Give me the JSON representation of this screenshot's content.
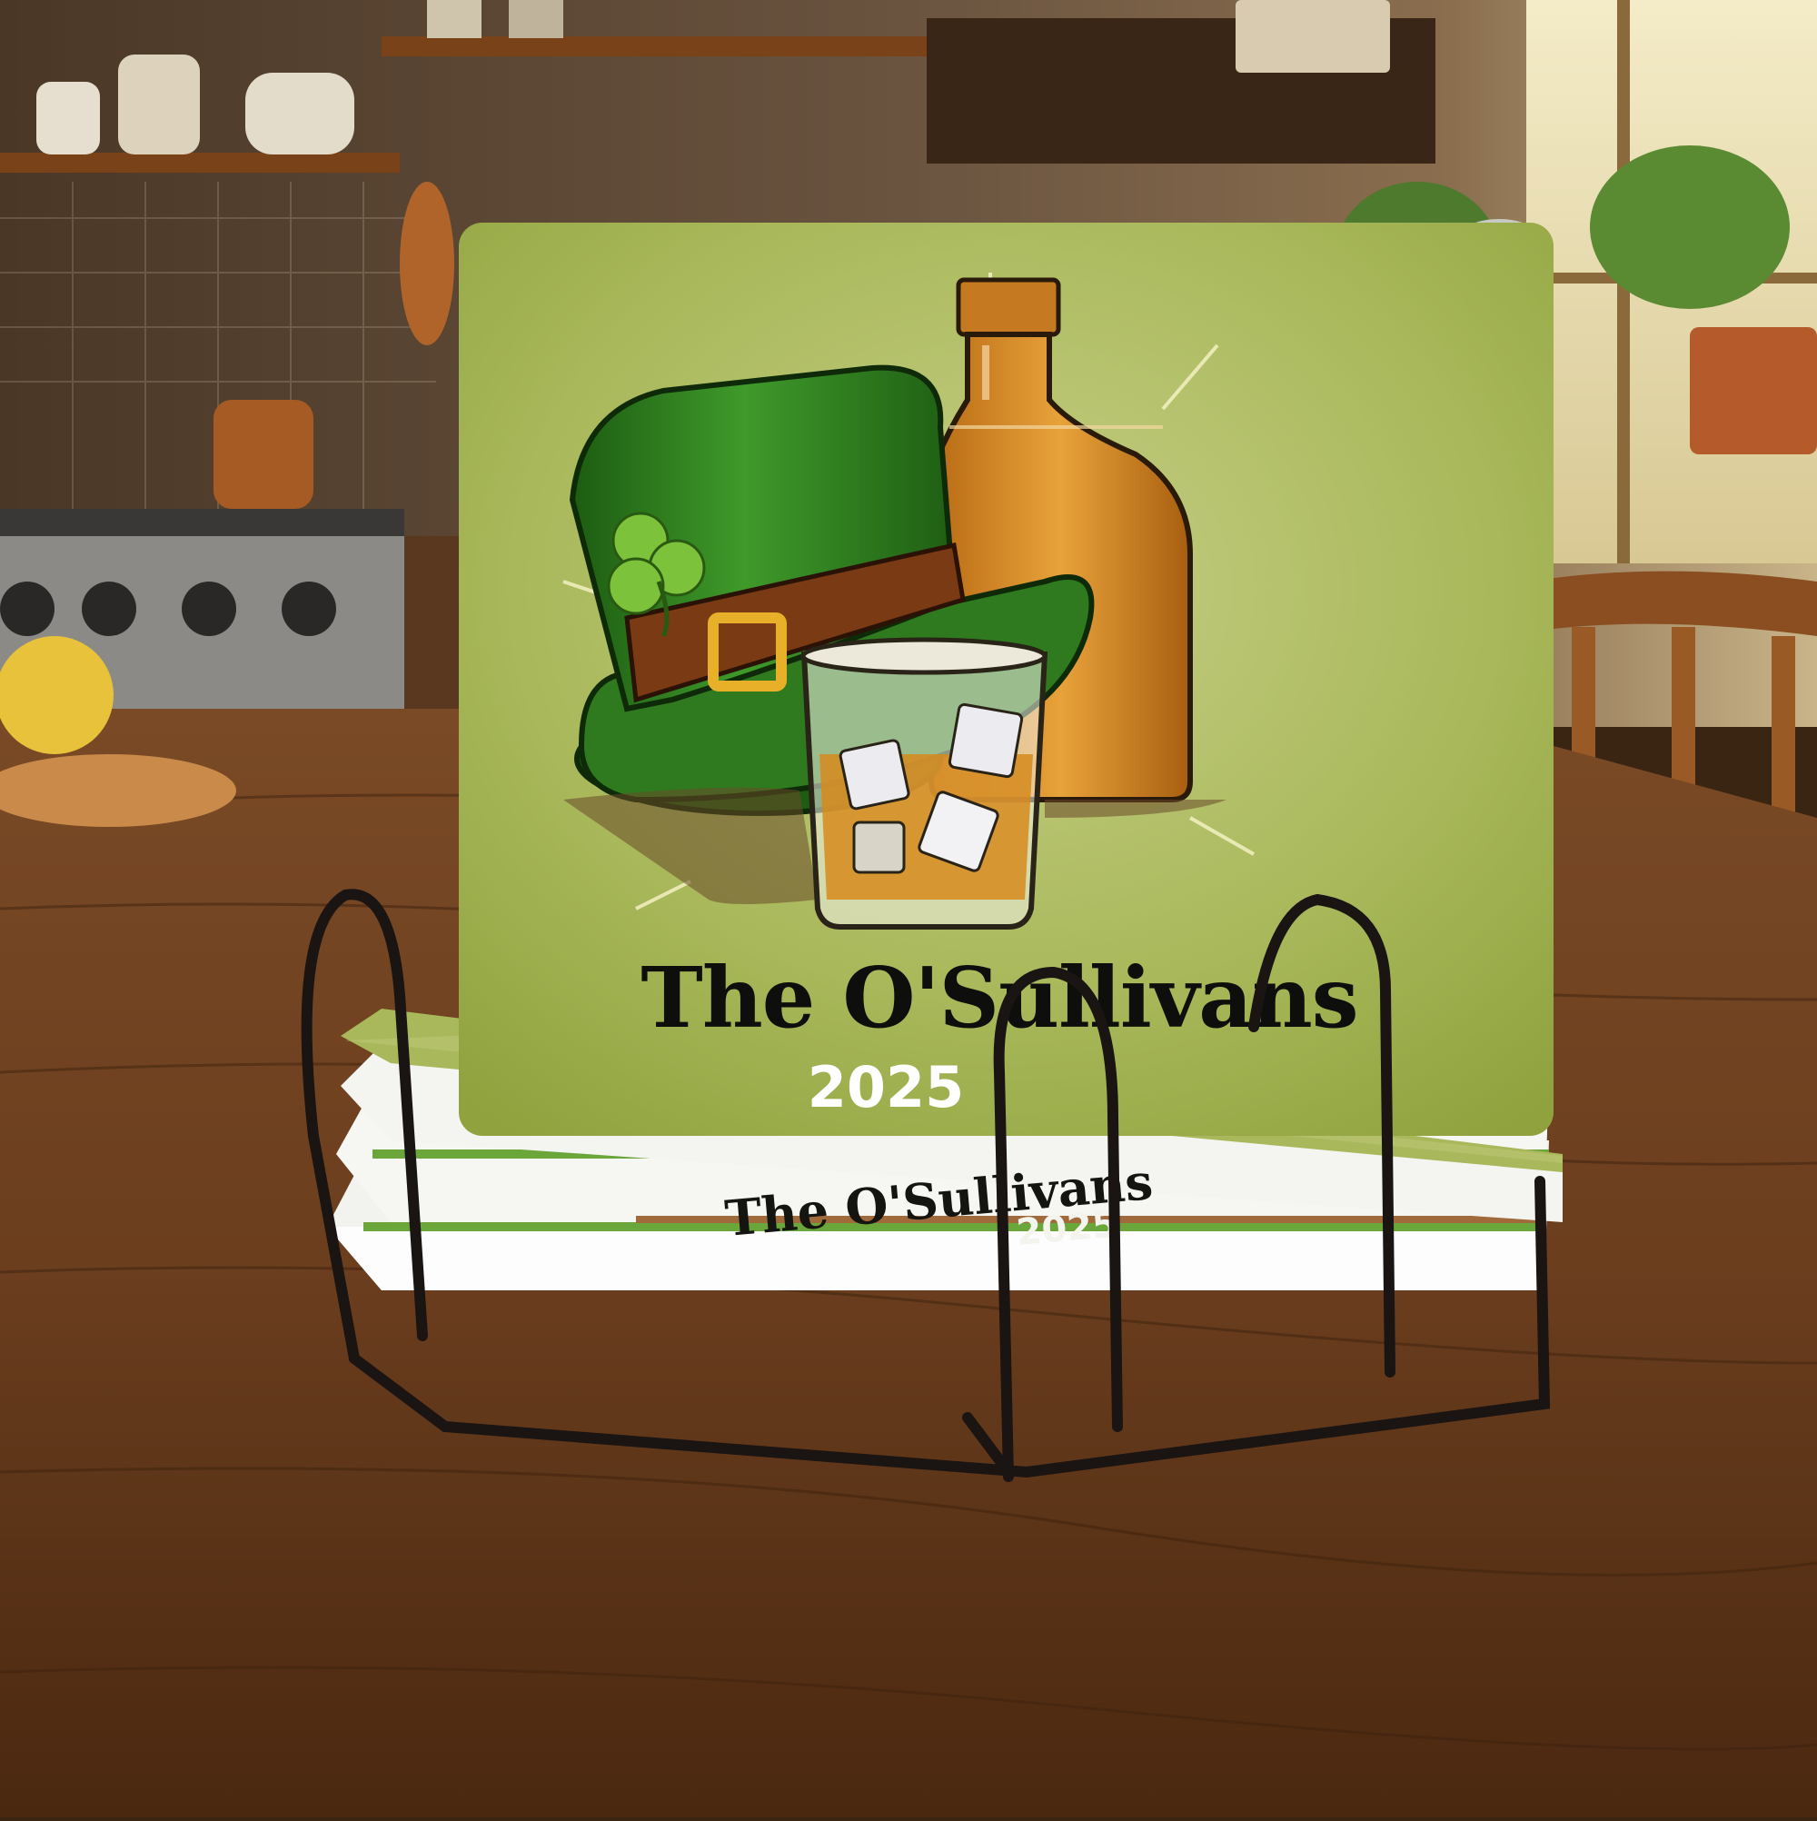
{
  "coaster": {
    "family_name": "The O'Sullivans",
    "year": "2025"
  },
  "stacked_coaster": {
    "family_name": "The O'Sullivans",
    "year": "2025"
  },
  "colors": {
    "coaster_green": "#a8b85a",
    "hat_green": "#2f7a1e",
    "whiskey_amber": "#d68a1c",
    "wood_table": "#6b3e1e",
    "rack_black": "#1a1412"
  },
  "icons": [
    "leprechaun-hat-icon",
    "shamrock-icon",
    "whiskey-bottle-icon",
    "whiskey-glass-icon"
  ]
}
